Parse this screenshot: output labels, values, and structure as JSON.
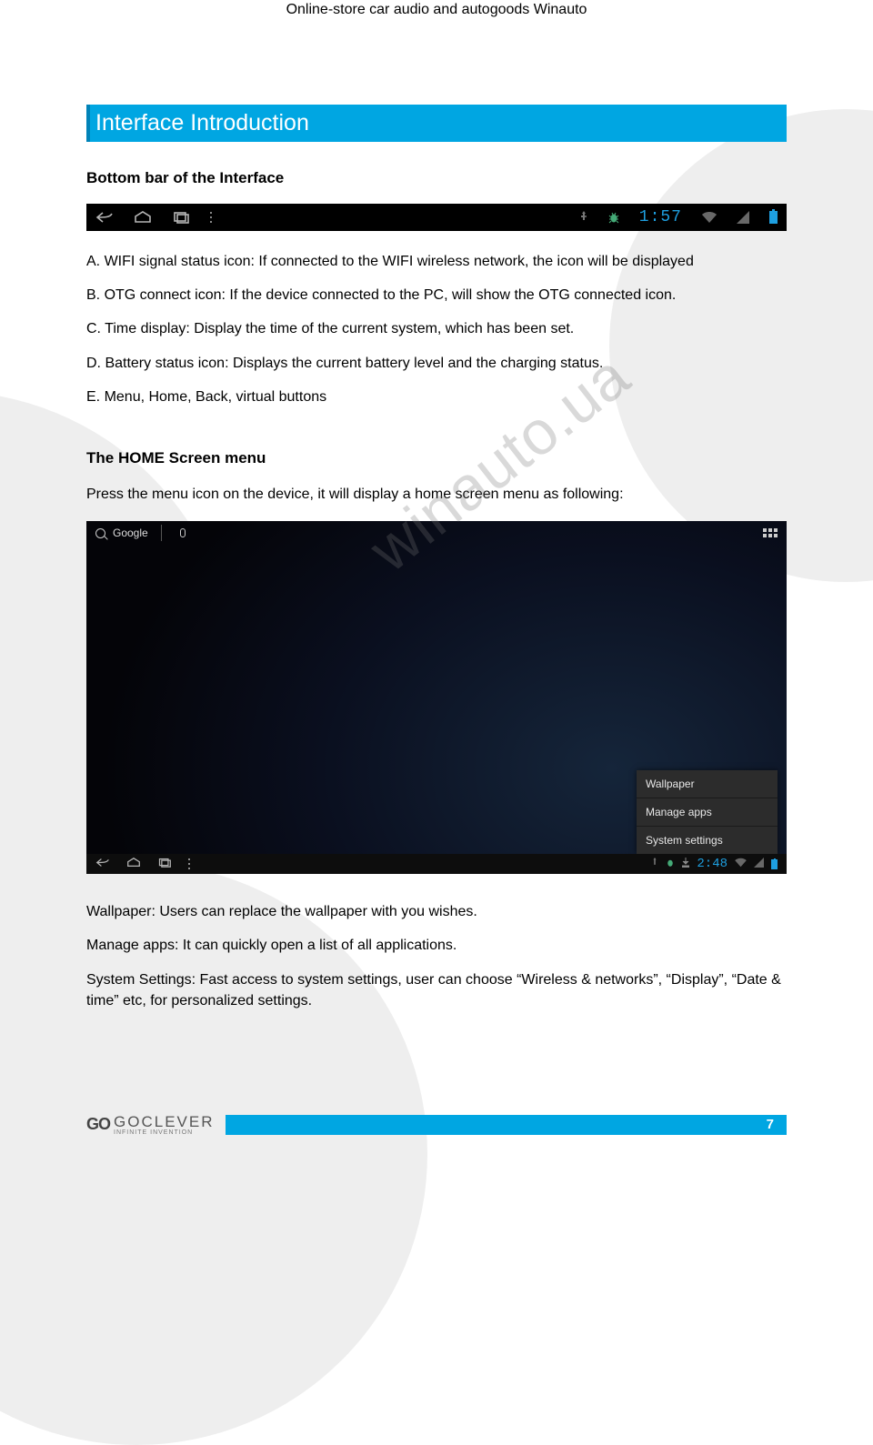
{
  "header": {
    "site_title": "Online-store car audio and autogoods Winauto"
  },
  "banner": {
    "title": "Interface Introduction"
  },
  "section1": {
    "heading": "Bottom bar of the Interface",
    "items": {
      "a": "A. WIFI signal status icon: If connected to the WIFI wireless network, the icon will be displayed",
      "b": "B. OTG connect icon: If the device connected to the PC, will show the OTG connected icon.",
      "c": "C. Time display: Display the time of the current system, which has been set.",
      "d": "D. Battery status icon: Displays the current battery level and the charging status.",
      "e": "E. Menu, Home, Back, virtual buttons"
    }
  },
  "bottom_bar": {
    "time": "1:57"
  },
  "section2": {
    "heading": "The HOME Screen menu",
    "intro": "Press the menu icon on the device, it will display a home screen menu as following:",
    "shot": {
      "search_label": "Google",
      "menu_items": [
        "Wallpaper",
        "Manage apps",
        "System settings"
      ],
      "time": "2:48"
    },
    "desc": {
      "wallpaper": "Wallpaper: Users can replace the wallpaper with you wishes.",
      "manage": "Manage apps: It can quickly open a list of all applications.",
      "system": "System Settings: Fast access to system settings, user can choose “Wireless & networks”, “Display”, “Date & time” etc, for personalized settings."
    }
  },
  "watermark": "winauto.ua",
  "footer": {
    "logo_bold": "GO",
    "logo_text": "GOCLEVER",
    "logo_sub": "INFINITE INVENTION",
    "page_number": "7"
  }
}
